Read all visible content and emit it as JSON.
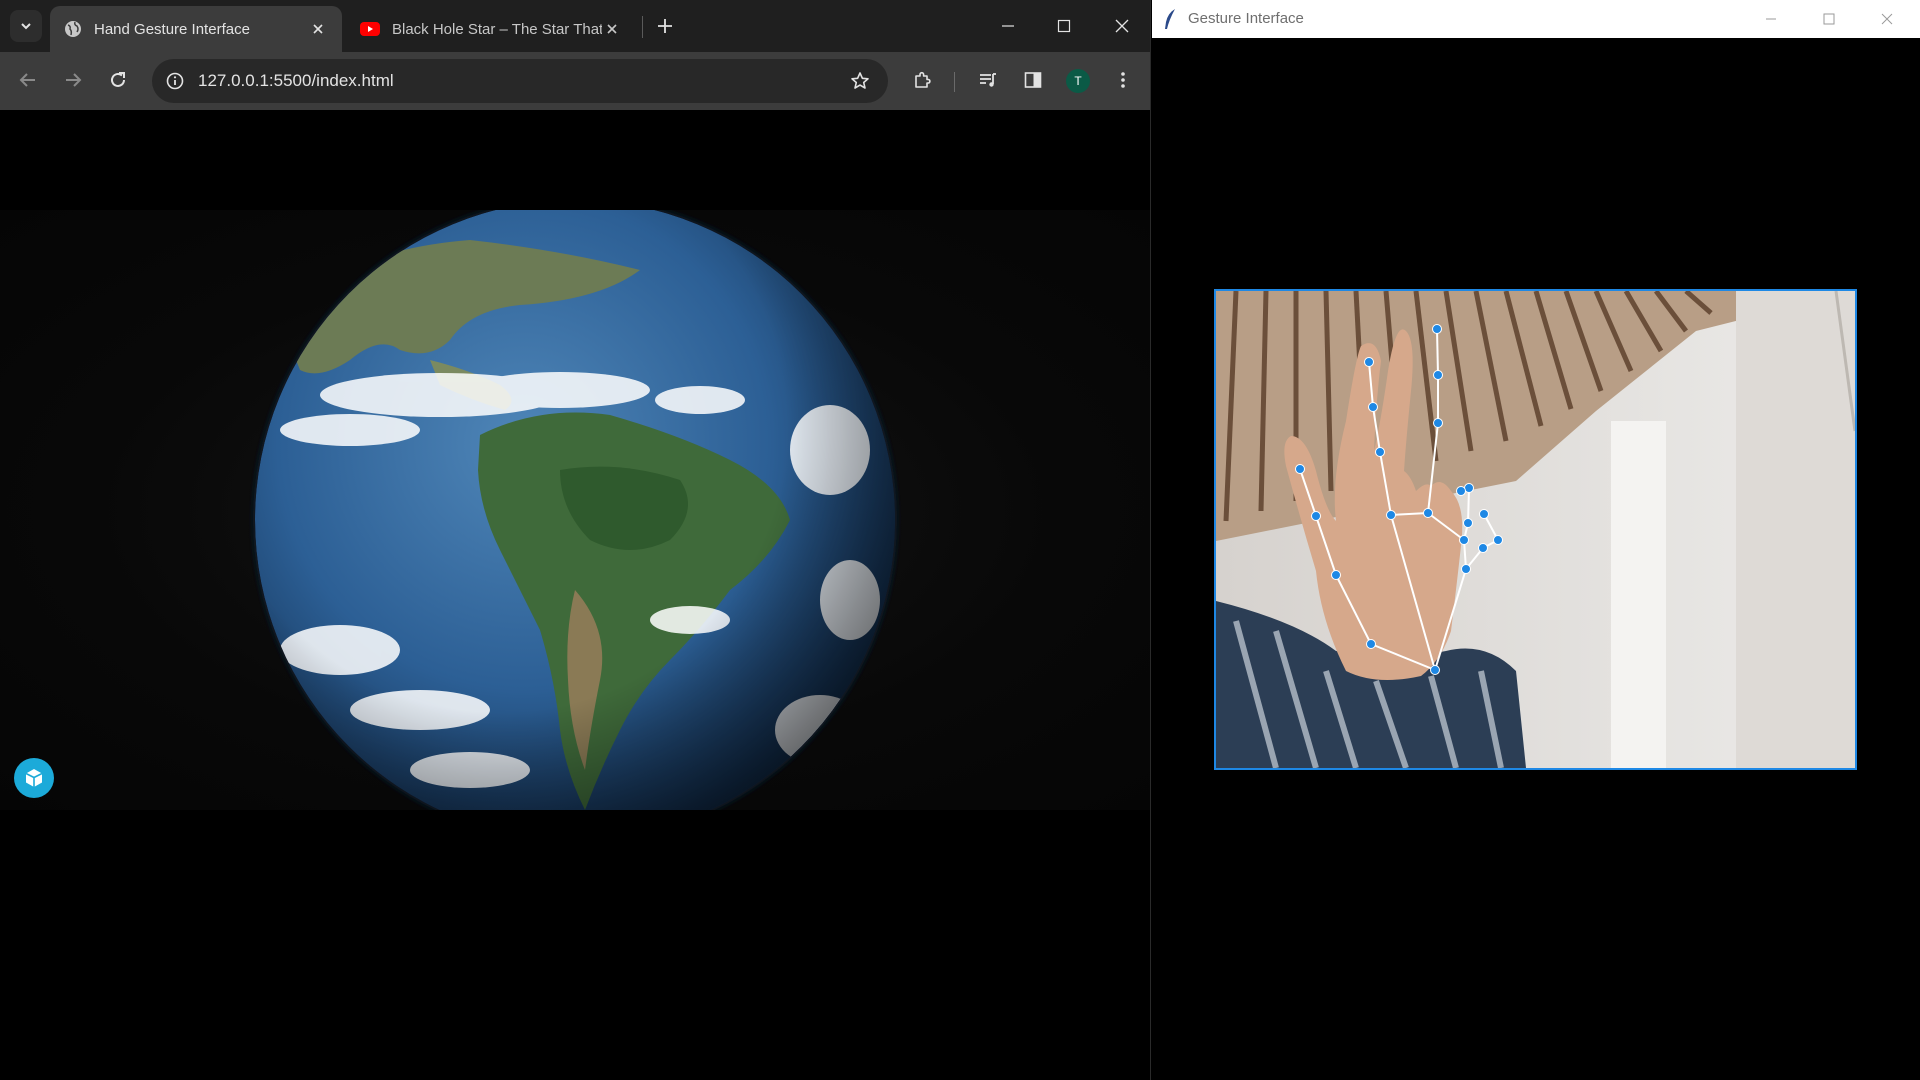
{
  "browser": {
    "tabs": [
      {
        "title": "Hand Gesture Interface",
        "active": true,
        "icon": "globe-icon"
      },
      {
        "title": "Black Hole Star – The Star That",
        "active": false,
        "icon": "youtube-icon"
      }
    ],
    "url": "127.0.0.1:5500/index.html",
    "profile_initial": "T",
    "colors": {
      "tabstrip": "#1f1f1f",
      "toolbar": "#3c3c3c",
      "profile": "#0b5a46",
      "youtube": "#ff0000"
    }
  },
  "viewer": {
    "model": "rotating-earth-globe",
    "badge_icon": "sketchfab-icon",
    "badge_color": "#1caad9"
  },
  "gesture_window": {
    "title": "Gesture Interface",
    "hand_landmarks": 21,
    "landmark_color": "#1e88e5",
    "connection_color": "#ffffff"
  }
}
